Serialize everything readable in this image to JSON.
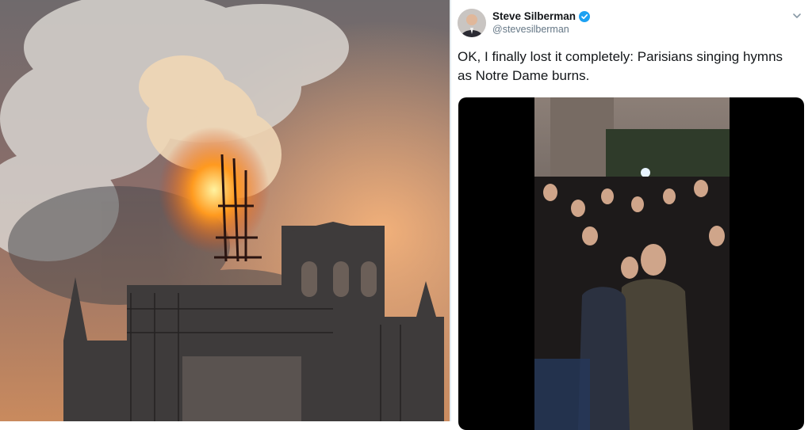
{
  "tweet": {
    "display_name": "Steve Silberman",
    "handle": "@stevesilberman",
    "text": "OK, I finally lost it completely: Parisians singing hymns as Notre Dame burns."
  },
  "icons": {
    "verified": "verified-badge-icon",
    "caret": "chevron-down-icon"
  },
  "colors": {
    "verified_blue": "#1da1f2",
    "text_primary": "#14171a",
    "text_secondary": "#657786"
  }
}
